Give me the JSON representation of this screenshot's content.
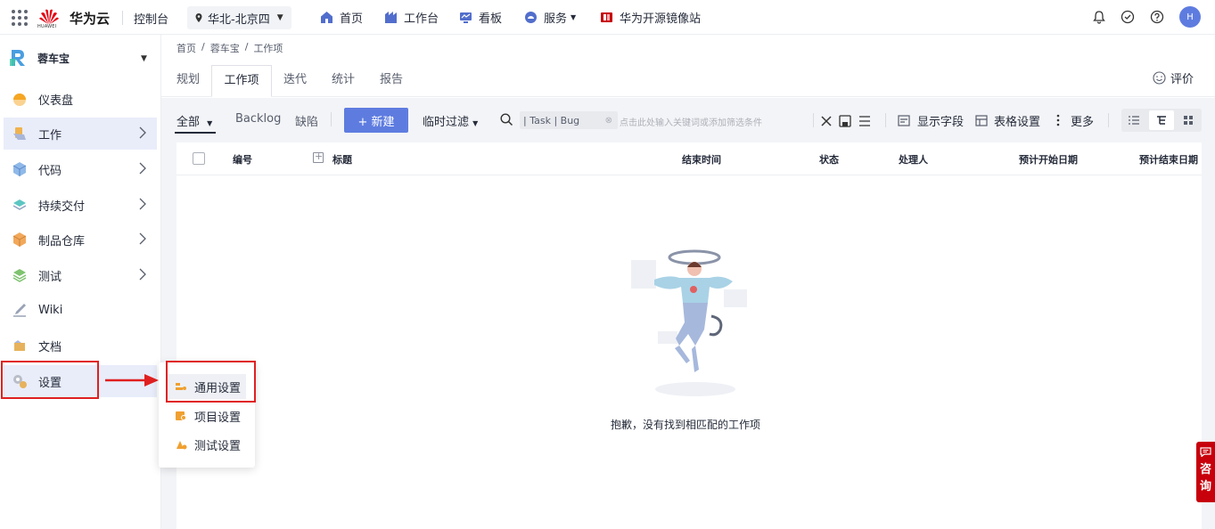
{
  "topbar": {
    "brand": "华为云",
    "logo_sub": "HUAWEI",
    "console": "控制台",
    "region": "华北-北京四",
    "nav": [
      {
        "label": "首页",
        "icon": "home-icon"
      },
      {
        "label": "工作台",
        "icon": "workbench-icon"
      },
      {
        "label": "看板",
        "icon": "dashboard-icon"
      },
      {
        "label": "服务",
        "icon": "service-icon"
      },
      {
        "label": "华为开源镜像站",
        "icon": "mirror-icon"
      }
    ],
    "avatar": "H"
  },
  "sidebar": {
    "project": "蓉车宝",
    "items": [
      {
        "label": "仪表盘",
        "color": "#f5a623"
      },
      {
        "label": "工作",
        "color": "#f0b24f"
      },
      {
        "label": "代码",
        "color": "#8fb9e8"
      },
      {
        "label": "持续交付",
        "color": "#5cc6c2"
      },
      {
        "label": "制品仓库",
        "color": "#f2a85a"
      },
      {
        "label": "测试",
        "color": "#7fc36f"
      },
      {
        "label": "Wiki",
        "color": "#9aa3b5"
      },
      {
        "label": "文档",
        "color": "#e7b25c"
      },
      {
        "label": "设置",
        "color": "#b8bdc8"
      }
    ]
  },
  "breadcrumb": [
    "首页",
    "/",
    "蓉车宝",
    "/",
    "工作项"
  ],
  "tabs": [
    "规划",
    "工作项",
    "迭代",
    "统计",
    "报告"
  ],
  "rate_label": "评价",
  "toolbar": {
    "all": "全部",
    "backlog": "Backlog",
    "defect": "缺陷",
    "new": "+ 新建",
    "temp_filter": "临时过滤",
    "filter_chip": "| Task | Bug",
    "search_placeholder": "点击此处输入关键词或添加筛选条件",
    "show_fields": "显示字段",
    "table_settings": "表格设置",
    "more": "更多"
  },
  "table": {
    "columns": [
      "编号",
      "标题",
      "结束时间",
      "状态",
      "处理人",
      "预计开始日期",
      "预计结束日期"
    ]
  },
  "empty_text": "抱歉，没有找到相匹配的工作项",
  "popup": [
    "通用设置",
    "项目设置",
    "测试设置"
  ],
  "consult": [
    "咨",
    "询"
  ]
}
